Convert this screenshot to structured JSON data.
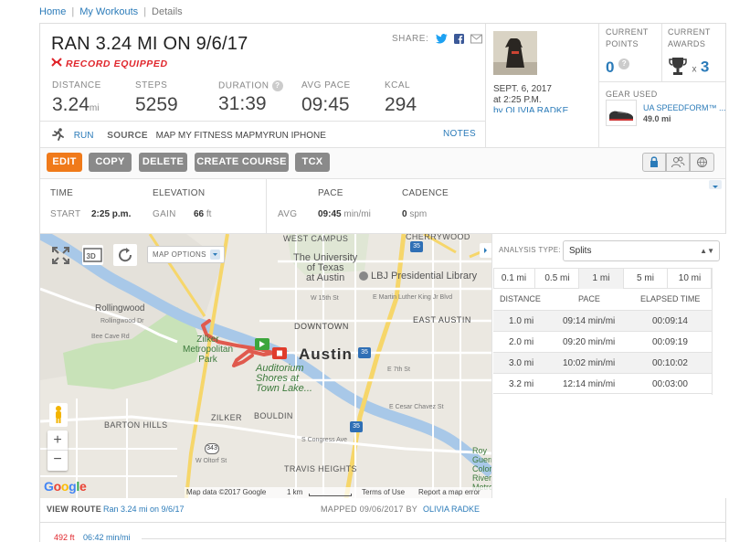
{
  "breadcrumb": {
    "home": "Home",
    "workouts": "My Workouts",
    "current": "Details"
  },
  "workout": {
    "title": "RAN 3.24 MI ON 9/6/17",
    "brand": "UNDER ARMOUR RECORD EQUIPPED",
    "share_label": "SHARE:"
  },
  "stats": [
    {
      "label": "DISTANCE",
      "value": "3.24",
      "unit": "mi"
    },
    {
      "label": "STEPS",
      "value": "5259",
      "unit": ""
    },
    {
      "label": "DURATION",
      "value": "31:39",
      "unit": ""
    },
    {
      "label": "AVG PACE",
      "value": "09:45",
      "unit": ""
    },
    {
      "label": "KCAL",
      "value": "294",
      "unit": ""
    }
  ],
  "source": {
    "activity": "RUN",
    "label": "SOURCE",
    "value": "MAP MY FITNESS MAPMYRUN IPHONE",
    "notes": "NOTES"
  },
  "side": {
    "date": "SEPT. 6, 2017",
    "time": "at 2:25 P.M.",
    "user": "by OLIVIA RADKE",
    "points_label": "CURRENT POINTS",
    "points": "0",
    "awards_label": "CURRENT AWARDS",
    "awards": "3",
    "awards_prefix": "x",
    "gear_label": "GEAR USED",
    "gear_name": "UA SPEEDFORM™ ...",
    "gear_dist": "49.0 mi"
  },
  "toolbar": {
    "edit": "EDIT",
    "copy": "COPY",
    "delete": "DELETE",
    "create_course": "CREATE COURSE",
    "tcx": "TCX"
  },
  "metrics": {
    "time_label": "TIME",
    "start_label": "START",
    "start": "2:25 p.m.",
    "elev_label": "ELEVATION",
    "gain_label": "GAIN",
    "gain": "66",
    "gain_unit": "ft",
    "pace_label": "PACE",
    "avg_label": "AVG",
    "avg": "09:45",
    "avg_unit": "min/mi",
    "cad_label": "CADENCE",
    "cad": "0",
    "cad_unit": "spm"
  },
  "map": {
    "options": "MAP OPTIONS",
    "city": "Austin",
    "streets": {
      "west_campus": "WEST CAMPUS",
      "cherrywood": "CHERRYWOOD",
      "univ1": "The University",
      "univ2": "of Texas",
      "univ3": "at Austin",
      "lbj": "LBJ Presidential Library",
      "rollingwood": "Rollingwood",
      "rollingwood_dr": "Rollingwood Dr",
      "bee_cave": "Bee Cave Rd",
      "downtown": "DOWNTOWN",
      "east_austin": "EAST AUSTIN",
      "zilker_park1": "Zilker",
      "zilker_park2": "Metropolitan",
      "zilker_park3": "Park",
      "auditorium1": "Auditorium",
      "auditorium2": "Shores at",
      "auditorium3": "Town Lake...",
      "barton_hills": "BARTON HILLS",
      "zilker": "ZILKER",
      "bouldin": "BOULDIN",
      "travis_heights": "TRAVIS HEIGHTS",
      "roy1": "Roy",
      "roy2": "Guerrero",
      "roy3": "Colorado",
      "roy4": "River M",
      "roy5": "Metro",
      "w15": "W 15th St",
      "e_mlk": "E Martin Luther King Jr Blvd",
      "e7th": "E 7th St",
      "e_cesar": "E Cesar Chavez St",
      "w_oltorf": "W Oltorf St",
      "s_congress": "S Congress Ave",
      "i35": "35",
      "r343": "343"
    },
    "attribution": "Map data ©2017 Google",
    "scale": "1 km",
    "terms": "Terms of Use",
    "report": "Report a map error",
    "google": "Google",
    "view_route_label": "VIEW ROUTE",
    "view_route": "Ran 3.24 mi on 9/6/17",
    "mapped": "MAPPED 09/06/2017 BY",
    "mapped_by": "OLIVIA RADKE"
  },
  "analysis": {
    "type_label": "ANALYSIS TYPE:",
    "type_value": "Splits",
    "tabs": [
      "0.1 mi",
      "0.5 mi",
      "1 mi",
      "5 mi",
      "10 mi"
    ],
    "headers": [
      "DISTANCE",
      "PACE",
      "ELAPSED TIME"
    ],
    "rows": [
      [
        "1.0 mi",
        "09:14 min/mi",
        "00:09:14"
      ],
      [
        "2.0 mi",
        "09:20 min/mi",
        "00:09:19"
      ],
      [
        "3.0 mi",
        "10:02 min/mi",
        "00:10:02"
      ],
      [
        "3.2 mi",
        "12:14 min/mi",
        "00:03:00"
      ]
    ]
  },
  "chart_footer": {
    "elev": "492 ft",
    "pace": "06:42 min/mi"
  },
  "colors": {
    "accent": "#f07a1a",
    "link": "#2b7bb9",
    "brand_red": "#e0262c",
    "route": "#e05a4e",
    "river": "#a8c8e8",
    "park": "#c8e2b8"
  }
}
